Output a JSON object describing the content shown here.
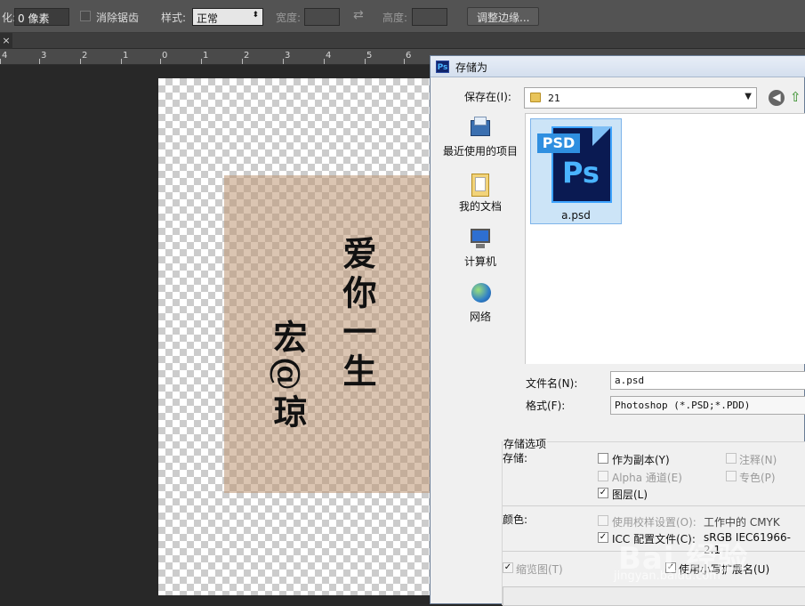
{
  "options_bar": {
    "feather_label": "化:",
    "feather_value": "0 像素",
    "antialias_label": "消除锯齿",
    "style_label": "样式:",
    "style_value": "正常",
    "width_label": "宽度:",
    "swap_glyph": "⇄",
    "height_label": "高度:",
    "refine_edge_button": "调整边缘..."
  },
  "tab": {
    "close_glyph": "×"
  },
  "ruler": {
    "labels": [
      "4",
      "3",
      "2",
      "1",
      "0",
      "1",
      "2",
      "3",
      "4",
      "5",
      "6"
    ]
  },
  "artwork": {
    "line_right": "爱你一生",
    "line_left": "宏@琼"
  },
  "dialog": {
    "title": "存储为",
    "app_icon": "Ps",
    "save_in_label": "保存在(I):",
    "save_in_value": "21",
    "nav": [
      {
        "label": "最近使用的项目",
        "icon": "recent-items-icon"
      },
      {
        "label": "我的文档",
        "icon": "documents-folder-icon"
      },
      {
        "label": "计算机",
        "icon": "computer-icon"
      },
      {
        "label": "网络",
        "icon": "network-globe-icon"
      }
    ],
    "files": [
      {
        "name": "a.psd",
        "badge": "PSD",
        "logo": "Ps"
      }
    ],
    "filename_label": "文件名(N):",
    "filename_value": "a.psd",
    "format_label": "格式(F):",
    "format_value": "Photoshop (*.PSD;*.PDD)",
    "options": {
      "group_title": "存储选项",
      "save_label": "存储:",
      "as_copy": {
        "label": "作为副本(Y)",
        "checked": false
      },
      "notes": {
        "label": "注释(N)",
        "checked": false,
        "disabled": true
      },
      "alpha": {
        "label": "Alpha 通道(E)",
        "checked": false,
        "disabled": true
      },
      "spot": {
        "label": "专色(P)",
        "checked": false,
        "disabled": true
      },
      "layers": {
        "label": "图层(L)",
        "checked": true
      },
      "color_label": "颜色:",
      "proof": {
        "label": "使用校样设置(O):",
        "extra": "工作中的 CMYK",
        "checked": false,
        "disabled": true
      },
      "icc": {
        "label": "ICC 配置文件(C):",
        "extra": "sRGB IEC61966-2.1",
        "checked": true
      },
      "thumbnail": {
        "label": "缩览图(T)",
        "checked": true,
        "disabled": true
      },
      "lowercase_ext": {
        "label": "使用小写扩展名(U)",
        "checked": true
      }
    }
  },
  "watermark": {
    "brand": "Bai 经验",
    "url": "jingyan.baidu.com"
  }
}
